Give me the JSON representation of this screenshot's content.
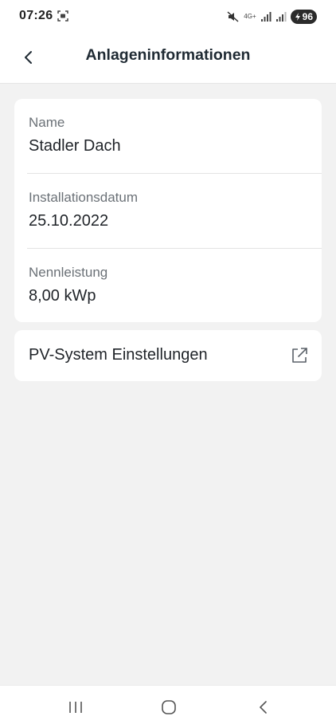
{
  "status_bar": {
    "time": "07:26",
    "network_label": "4G+",
    "battery": "96"
  },
  "app_bar": {
    "title": "Anlageninformationen"
  },
  "info": {
    "items": [
      {
        "label": "Name",
        "value": "Stadler Dach"
      },
      {
        "label": "Installationsdatum",
        "value": "25.10.2022"
      },
      {
        "label": "Nennleistung",
        "value": "8,00 kWp"
      }
    ]
  },
  "settings": {
    "label": "PV-System Einstellungen"
  },
  "icons": {
    "back": "chevron-left-icon",
    "external": "external-link-icon",
    "nav_recents": "recents-icon",
    "nav_home": "home-icon",
    "nav_back": "back-icon"
  }
}
